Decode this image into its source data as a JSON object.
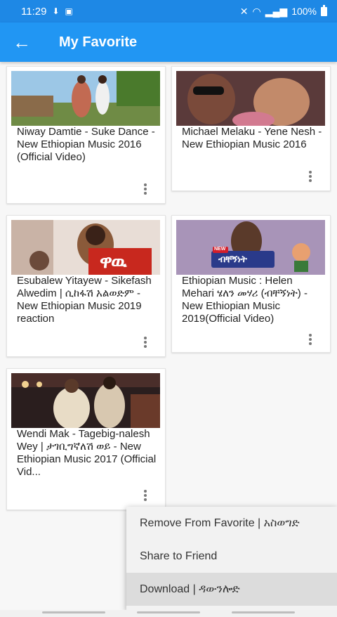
{
  "status": {
    "time": "11:29",
    "battery": "100%"
  },
  "appbar": {
    "title": "My Favorite"
  },
  "videos": [
    {
      "title": "Niway Damtie - Suke Dance - New Ethiopian Music 2016 (Official Video)"
    },
    {
      "title": "Michael Melaku - Yene Nesh - New Ethiopian Music 2016"
    },
    {
      "title": "Esubalew Yitayew - Sikefash Alwedim | ሲከፋሽ አልወድም - New Ethiopian Music 2019  reaction"
    },
    {
      "title": "Ethiopian Music : Helen Mehari ሄለን መሃሪ (ብቸኝነት) - New Ethiopian Music 2019(Official Video)"
    },
    {
      "title": "Wendi Mak - Tagebig-nalesh Wey | ታገቢግኛለሽ ወይ - New Ethiopian Music 2017 (Official Vid..."
    }
  ],
  "thumb_text": {
    "we": "ዋዉ",
    "new": "NEW",
    "bichegninet": "ብቸኝነት"
  },
  "menu": {
    "items": [
      {
        "label": "Remove From Favorite | አስወግድ"
      },
      {
        "label": "Share to Friend"
      },
      {
        "label": "Download | ዳውንሎድ"
      }
    ]
  },
  "colors": {
    "status_bar": "#1e88e5",
    "app_bar": "#2196f3",
    "menu_highlight": "#dcdcdc"
  }
}
